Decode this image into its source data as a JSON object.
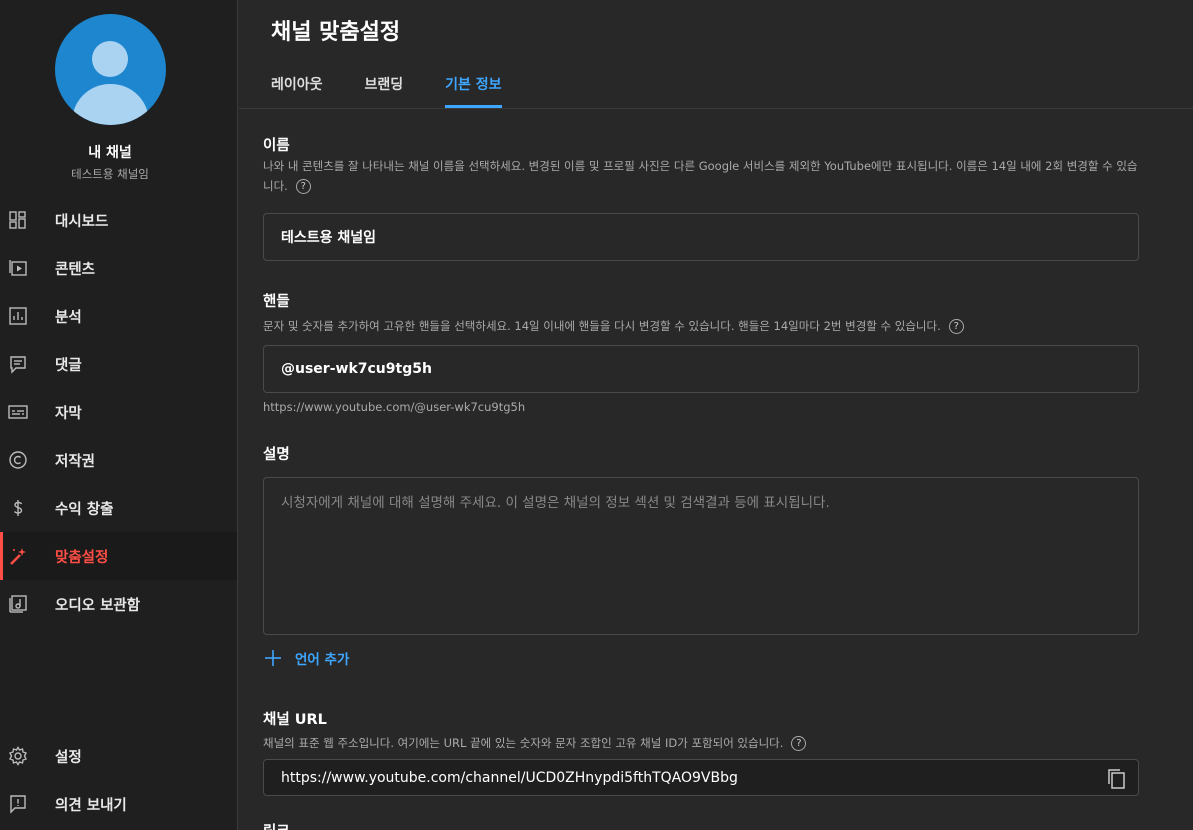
{
  "sidebar": {
    "channel_title": "내 채널",
    "channel_name": "테스트용 채널임",
    "items": [
      {
        "label": "대시보드",
        "icon": "dashboard-icon"
      },
      {
        "label": "콘텐츠",
        "icon": "content-icon"
      },
      {
        "label": "분석",
        "icon": "analytics-icon"
      },
      {
        "label": "댓글",
        "icon": "comments-icon"
      },
      {
        "label": "자막",
        "icon": "subtitles-icon"
      },
      {
        "label": "저작권",
        "icon": "copyright-icon"
      },
      {
        "label": "수익 창출",
        "icon": "monetization-icon"
      },
      {
        "label": "맞춤설정",
        "icon": "customization-icon",
        "active": true
      },
      {
        "label": "오디오 보관함",
        "icon": "audio-library-icon"
      }
    ],
    "bottom_items": [
      {
        "label": "설정",
        "icon": "settings-icon"
      },
      {
        "label": "의견 보내기",
        "icon": "feedback-icon"
      }
    ],
    "active_color": "#ff4e45"
  },
  "header": {
    "title": "채널 맞춤설정",
    "tabs": [
      {
        "label": "레이아웃"
      },
      {
        "label": "브랜딩"
      },
      {
        "label": "기본 정보",
        "active": true
      }
    ],
    "accent_color": "#3ea6ff"
  },
  "main": {
    "name": {
      "title": "이름",
      "desc": "나와 내 콘텐츠를 잘 나타내는 채널 이름을 선택하세요. 변경된 이름 및 프로필 사진은 다른 Google 서비스를 제외한 YouTube에만 표시됩니다. 이름은 14일 내에 2회 변경할 수 있습니다.",
      "value": "테스트용 채널임"
    },
    "handle": {
      "title": "핸들",
      "desc": "문자 및 숫자를 추가하여 고유한 핸들을 선택하세요. 14일 이내에 핸들을 다시 변경할 수 있습니다. 핸들은 14일마다 2번 변경할 수 있습니다.",
      "value": "@user-wk7cu9tg5h",
      "url": "https://www.youtube.com/@user-wk7cu9tg5h"
    },
    "description": {
      "title": "설명",
      "placeholder": "시청자에게 채널에 대해 설명해 주세요. 이 설명은 채널의 정보 섹션 및 검색결과 등에 표시됩니다.",
      "add_language": "언어 추가"
    },
    "channel_url": {
      "title": "채널 URL",
      "desc": "채널의 표준 웹 주소입니다. 여기에는 URL 끝에 있는 숫자와 문자 조합인 고유 채널 ID가 포함되어 있습니다.",
      "value": "https://www.youtube.com/channel/UCD0ZHnypdi5fthTQAO9VBbg"
    },
    "links": {
      "title": "링크"
    },
    "help_glyph": "?"
  }
}
